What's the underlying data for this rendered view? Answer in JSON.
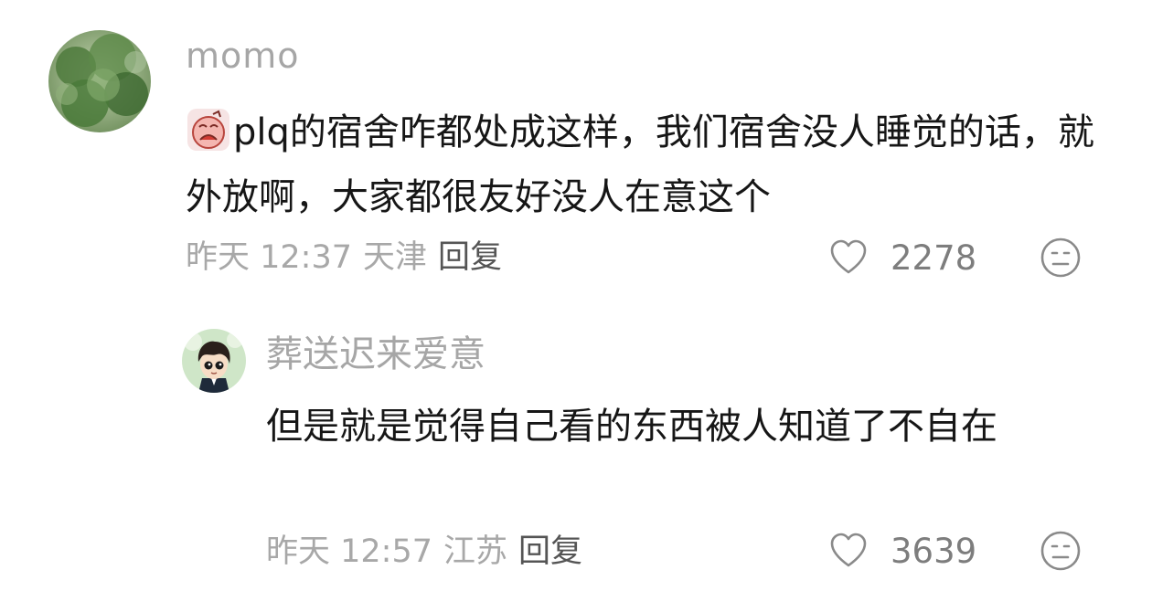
{
  "comments": [
    {
      "username": "momo",
      "emoji_icon": "crying-face-emoji-icon",
      "text": "plq的宿舍咋都处成这样，我们宿舍没人睡觉的话，就外放啊，大家都很友好没人在意这个",
      "time": "昨天 12:37",
      "location": "天津",
      "reply_label": "回复",
      "likes": "2278",
      "avatar_icon": "tree-photo-avatar",
      "like_icon": "heart-icon",
      "dislike_icon": "neutral-face-icon"
    },
    {
      "username": "葬送迟来爱意",
      "text": "但是就是觉得自己看的东西被人知道了不自在",
      "time": "昨天 12:57",
      "location": "江苏",
      "reply_label": "回复",
      "likes": "3639",
      "avatar_icon": "cartoon-boy-avatar",
      "like_icon": "heart-icon",
      "dislike_icon": "neutral-face-icon"
    }
  ],
  "colors": {
    "username": "#a6a6a6",
    "body_text": "#161616",
    "meta_text": "#a8a8a8",
    "reply_text": "#555555",
    "icon_stroke": "#8a8a8a"
  }
}
